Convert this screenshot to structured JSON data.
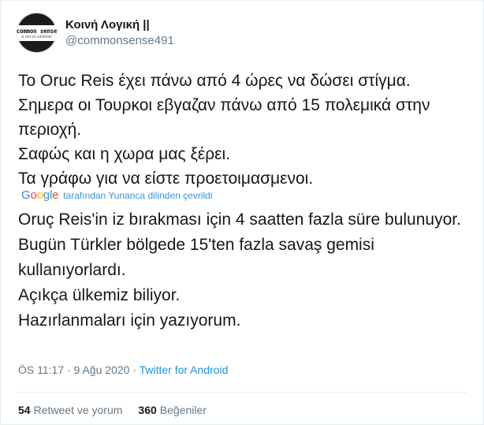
{
  "user": {
    "display_name": "Κοινή Λογική ||",
    "handle": "@commonsense491",
    "avatar_text": "common sense",
    "avatar_subtext": "is not so common"
  },
  "tweet": {
    "text": "Το Oruc Reis έχει πάνω από 4 ώρες να δώσει στίγμα.\nΣημερα οι Τουρκοι εβγαζαν πάνω από 15 πολεμικά στην περιοχή.\nΣαφώς και η χωρα μας ξέρει.\nΤα γράφω για να είστε προετοιμασμενοι."
  },
  "translation": {
    "logo": {
      "g1": "G",
      "o1": "o",
      "o2": "o",
      "g2": "g",
      "l": "l",
      "e": "e"
    },
    "label": "tarafından Yunanca dilinden çevrildi",
    "text": "Oruç Reis'in iz bırakması için 4 saatten fazla süre bulunuyor.\n Bugün Türkler bölgede 15'ten fazla savaş gemisi kullanıyorlardı.\n Açıkça ülkemiz biliyor.\n Hazırlanmaları için yazıyorum."
  },
  "meta": {
    "timestamp": "ÖS 11:17 · 9 Ağu 2020 · ",
    "source": "Twitter for Android"
  },
  "stats": {
    "retweets_count": "54",
    "retweets_label": "Retweet ve yorum",
    "likes_count": "360",
    "likes_label": "Beğeniler"
  },
  "colors": {
    "link": "#1b95e0",
    "secondary_text": "#657786",
    "primary_text": "#14171a"
  }
}
